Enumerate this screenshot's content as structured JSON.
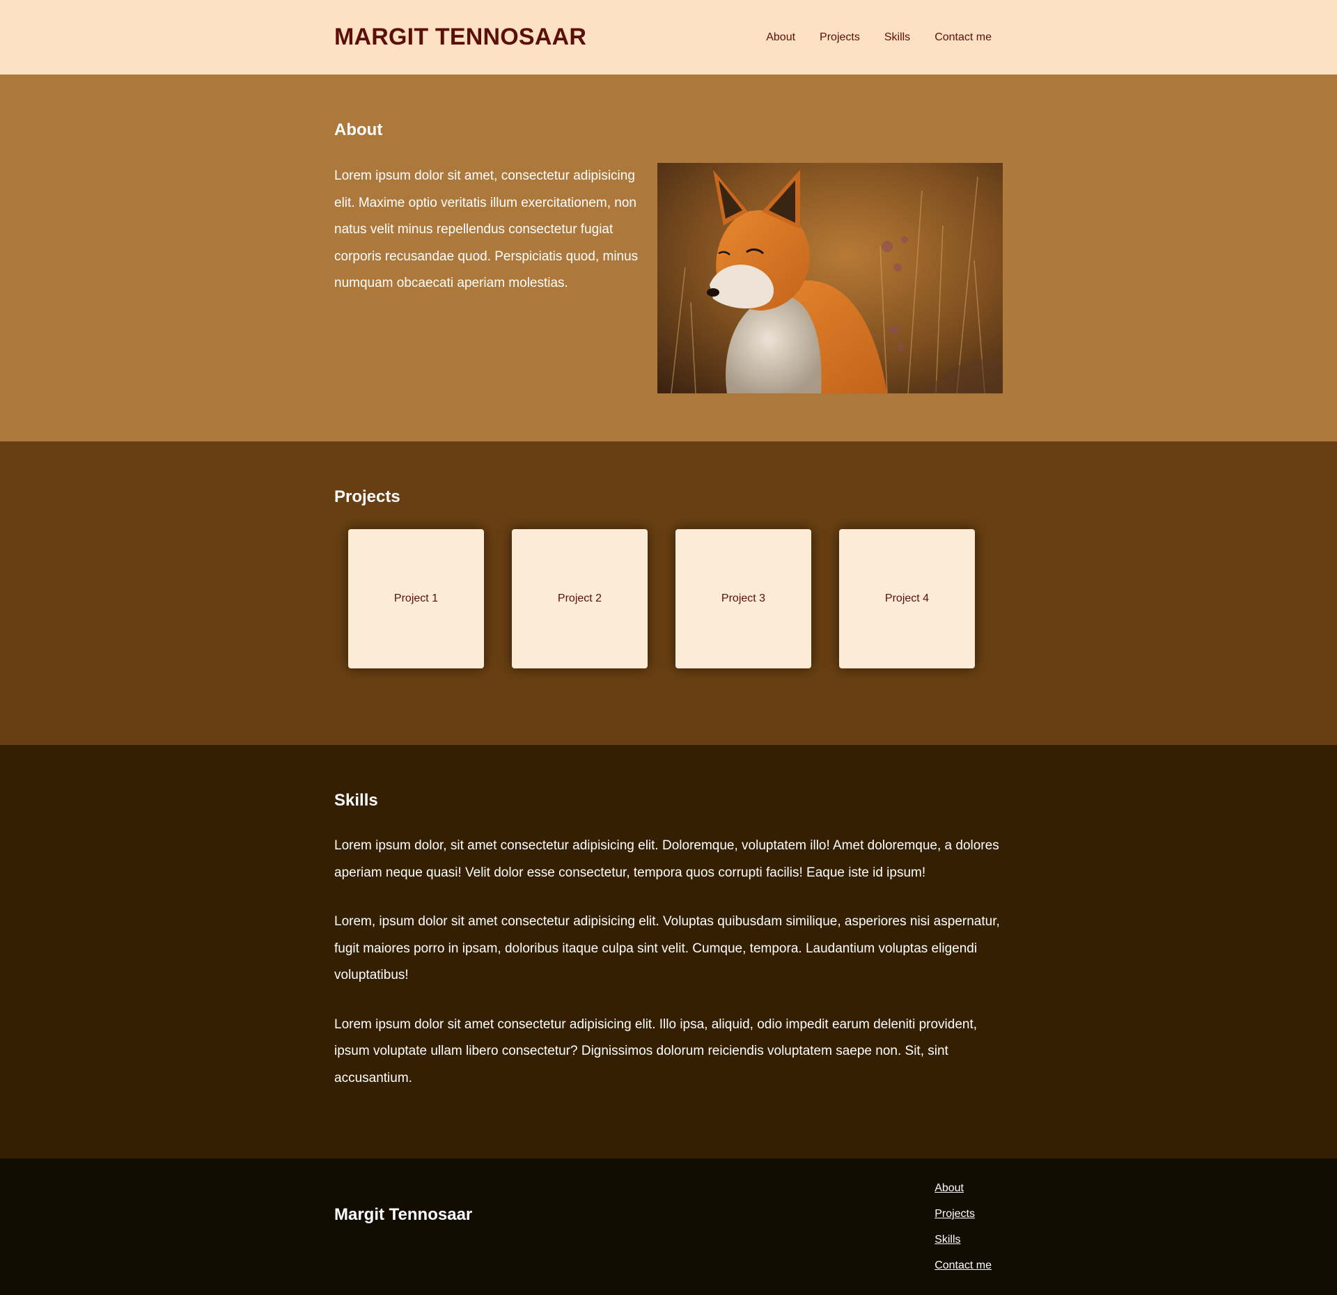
{
  "header": {
    "brand": "MARGIT TENNOSAAR",
    "nav": [
      "About",
      "Projects",
      "Skills",
      "Contact me"
    ]
  },
  "about": {
    "title": "About",
    "text": "Lorem ipsum dolor sit amet, consectetur adipisicing elit. Maxime optio veritatis illum exercitationem, non natus velit minus repellendus consectetur fugiat corporis recusandae quod. Perspiciatis quod, minus numquam obcaecati aperiam molestias.",
    "photo_subject": "fox-photo"
  },
  "projects": {
    "title": "Projects",
    "cards": [
      "Project 1",
      "Project 2",
      "Project 3",
      "Project 4"
    ]
  },
  "skills": {
    "title": "Skills",
    "paragraphs": [
      "Lorem ipsum dolor, sit amet consectetur adipisicing elit. Doloremque, voluptatem illo! Amet doloremque, a dolores aperiam neque quasi! Velit dolor esse consectetur, tempora quos corrupti facilis! Eaque iste id ipsum!",
      "Lorem, ipsum dolor sit amet consectetur adipisicing elit. Voluptas quibusdam similique, asperiores nisi aspernatur, fugit maiores porro in ipsam, doloribus itaque culpa sint velit. Cumque, tempora. Laudantium voluptas eligendi voluptatibus!",
      "Lorem ipsum dolor sit amet consectetur adipisicing elit. Illo ipsa, aliquid, odio impedit earum deleniti provident, ipsum voluptate ullam libero consectetur? Dignissimos dolorum reiciendis voluptatem saepe non. Sit, sint accusantium."
    ]
  },
  "footer": {
    "name": "Margit Tennosaar",
    "links": [
      "About",
      "Projects",
      "Skills",
      "Contact me"
    ]
  },
  "colors": {
    "header_bg": "#fee1c3",
    "brand_text": "#5a0f0a",
    "about_bg": "#ac783b",
    "projects_bg": "#683f12",
    "card_bg": "#fbebd7",
    "skills_bg": "#351f03",
    "footer_bg": "#130c02"
  }
}
